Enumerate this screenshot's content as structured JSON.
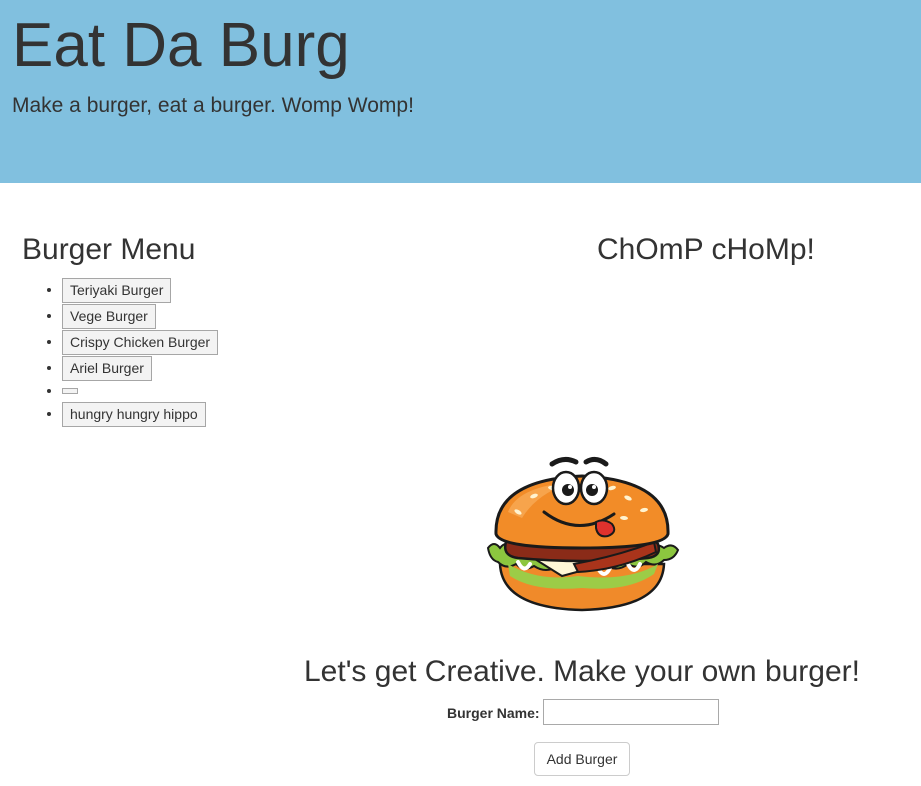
{
  "header": {
    "title": "Eat Da Burg",
    "tagline": "Make a burger, eat a burger. Womp Womp!",
    "background_color": "#81c0df"
  },
  "menu": {
    "heading": "Burger Menu",
    "items": [
      {
        "label": "Teriyaki Burger"
      },
      {
        "label": "Vege Burger"
      },
      {
        "label": "Crispy Chicken Burger"
      },
      {
        "label": "Ariel Burger"
      },
      {
        "label": ""
      },
      {
        "label": "hungry hungry hippo"
      }
    ]
  },
  "devoured": {
    "heading": "ChOmP cHoMp!",
    "items": []
  },
  "mascot": {
    "icon": "cartoon-burger-mascot"
  },
  "create_form": {
    "heading": "Let's get Creative. Make your own burger!",
    "name_label": "Burger Name:",
    "name_value": "",
    "submit_label": "Add Burger"
  }
}
